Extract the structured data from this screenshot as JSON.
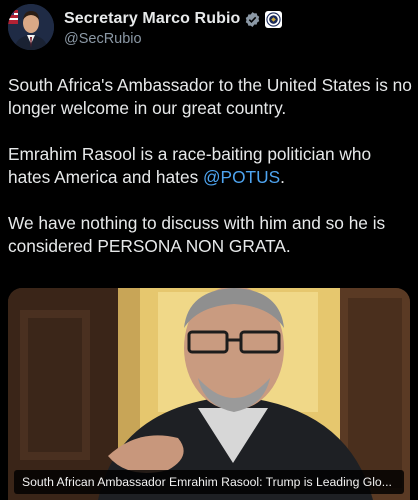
{
  "author": {
    "display_name": "Secretary Marco Rubio",
    "handle": "@SecRubio",
    "verified_icon": "verified-badge-icon",
    "affiliation_icon": "government-seal-icon"
  },
  "tweet": {
    "paragraph_1": "South Africa's Ambassador to the United States is no longer welcome in our great country.",
    "paragraph_2_before_mention": "Emrahim Rasool is a race-baiting politician who hates America and hates ",
    "mention": "@POTUS",
    "paragraph_2_after_mention": ".",
    "paragraph_3": "We have nothing to discuss with him and so he is considered PERSONA NON GRATA."
  },
  "media": {
    "caption": "South African Ambassador Emrahim Rasool: Trump is Leading Glo..."
  },
  "colors": {
    "background": "#000000",
    "text": "#e7e9ea",
    "secondary_text": "#8b98a5",
    "mention": "#4ea4f0",
    "verified": "#1d9bf0"
  }
}
